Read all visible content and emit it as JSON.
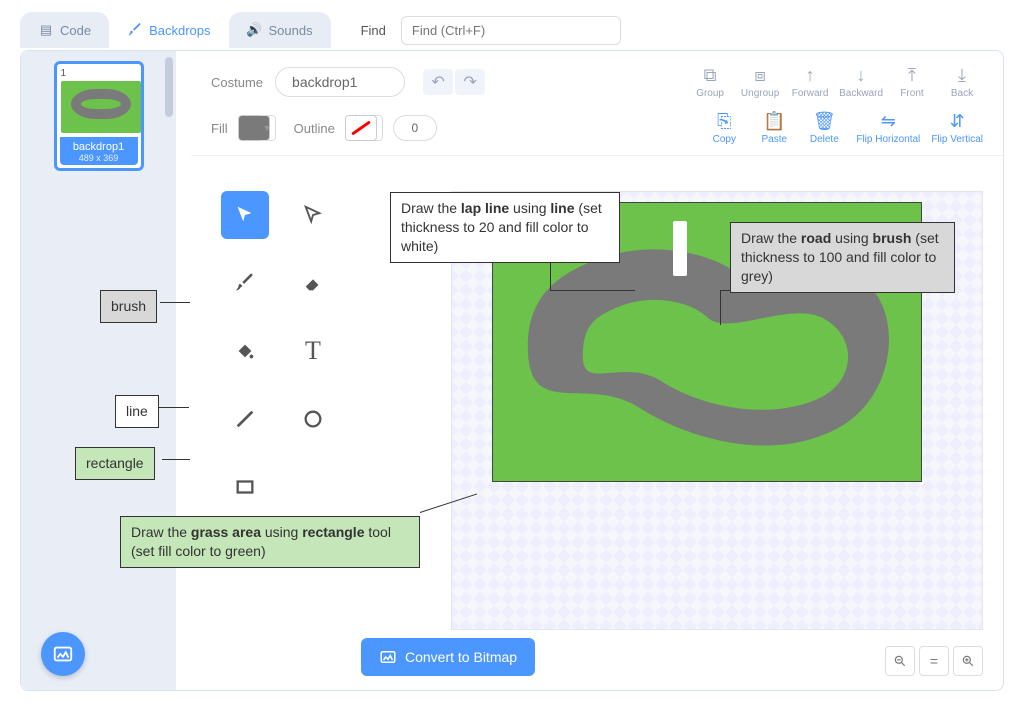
{
  "tabs": {
    "code": "Code",
    "backdrops": "Backdrops",
    "sounds": "Sounds"
  },
  "find": {
    "label": "Find",
    "placeholder": "Find (Ctrl+F)"
  },
  "sidebar": {
    "thumb_num": "1",
    "thumb_name": "backdrop1",
    "thumb_dim": "489 x 369"
  },
  "editor": {
    "costume_label": "Costume",
    "costume_name": "backdrop1",
    "fill_label": "Fill",
    "outline_label": "Outline",
    "outline_thickness": "0",
    "btn_group": "Group",
    "btn_ungroup": "Ungroup",
    "btn_forward": "Forward",
    "btn_backward": "Backward",
    "btn_front": "Front",
    "btn_back": "Back",
    "btn_copy": "Copy",
    "btn_paste": "Paste",
    "btn_delete": "Delete",
    "btn_fliph": "Flip Horizontal",
    "btn_flipv": "Flip Vertical",
    "convert": "Convert to Bitmap"
  },
  "zoom": {
    "out": "⊖",
    "reset": "=",
    "in": "⊕"
  },
  "annotations": {
    "brush": "brush",
    "line": "line",
    "rectangle": "rectangle",
    "lap": "Draw the <b>lap line</b> using <b>line</b> (set thickness to 20 and fill color to white)",
    "road": "Draw the <b>road</b> using <b>brush</b> (set thickness to 100 and fill color to grey)",
    "grass": "Draw the <b>grass area</b> using <b>rectangle</b> tool (set fill color to green)"
  }
}
